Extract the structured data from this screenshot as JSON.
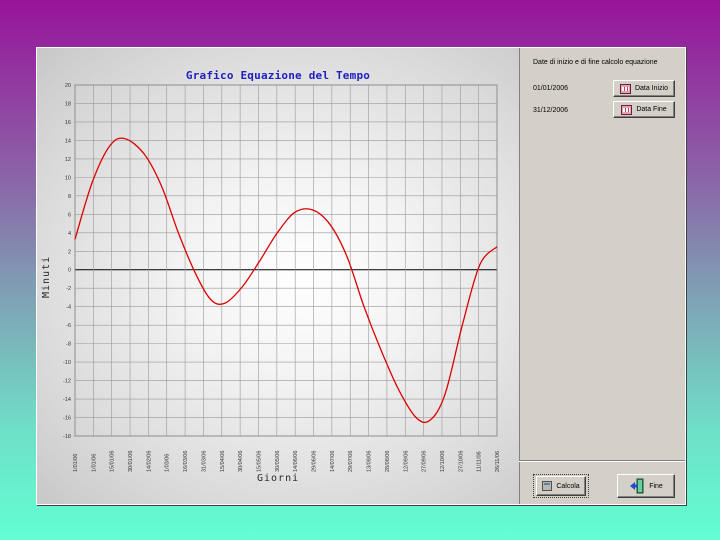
{
  "chart_data": {
    "type": "line",
    "title": "Grafico Equazione del Tempo",
    "xlabel": "Giorni",
    "ylabel": "Minuti",
    "ylim": [
      -18,
      20
    ],
    "yticks": [
      "20",
      "18",
      "16",
      "14",
      "12",
      "10",
      "8",
      "6",
      "4",
      "2",
      "0",
      "-2",
      "-4",
      "-6",
      "-8",
      "-10",
      "-12",
      "-14",
      "-16",
      "-18"
    ],
    "xticks": [
      "1/01/06",
      "1/01/06",
      "15/01/06",
      "30/01/06",
      "14/02/06",
      "1/03/06",
      "16/03/06",
      "31/03/06",
      "15/04/06",
      "30/04/06",
      "15/05/06",
      "30/05/06",
      "14/06/06",
      "29/06/06",
      "14/07/06",
      "29/07/06",
      "13/08/06",
      "28/08/06",
      "12/09/06",
      "27/09/06",
      "12/10/06",
      "27/10/06",
      "11/11/06",
      "26/11/06"
    ],
    "grid": true,
    "series": [
      {
        "color": "#dd0000",
        "x": [
          0,
          15,
          30,
          43,
          60,
          75,
          90,
          105,
          118,
          130,
          145,
          160,
          175,
          190,
          205,
          220,
          235,
          250,
          265,
          280,
          295,
          307,
          320,
          335,
          350,
          365
        ],
        "y": [
          3.3,
          9.5,
          13.4,
          14.2,
          12.5,
          9.0,
          3.8,
          -0.6,
          -3.3,
          -3.6,
          -1.8,
          1.0,
          4.0,
          6.2,
          6.5,
          5.0,
          1.5,
          -4.0,
          -8.8,
          -13.0,
          -16.0,
          -16.3,
          -13.5,
          -6.0,
          0.5,
          2.5
        ]
      }
    ]
  },
  "panel": {
    "label": "Date di inizio e di fine calcolo equazione",
    "start_date": "01/01/2006",
    "end_date": "31/12/2006",
    "start_button": "Data Inizio",
    "end_button": "Data Fine",
    "calc_button": "Calcola",
    "exit_button": "Fine"
  }
}
